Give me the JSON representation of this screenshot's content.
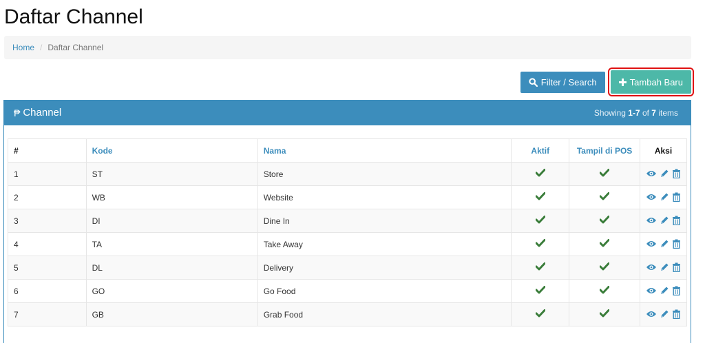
{
  "page": {
    "title": "Daftar Channel"
  },
  "breadcrumb": {
    "home": "Home",
    "separator": "/",
    "current": "Daftar Channel"
  },
  "toolbar": {
    "filter_label": "Filter / Search",
    "add_label": "Tambah Baru"
  },
  "panel": {
    "currency_icon": "₱",
    "title": "Channel",
    "showing_prefix": "Showing ",
    "range": "1-7",
    "of": " of ",
    "total": "7",
    "suffix": " items"
  },
  "table": {
    "headers": {
      "num": "#",
      "kode": "Kode",
      "nama": "Nama",
      "aktif": "Aktif",
      "tampil": "Tampil di POS",
      "aksi": "Aksi"
    },
    "rows": [
      {
        "num": "1",
        "kode": "ST",
        "nama": "Store",
        "aktif": true,
        "tampil": true
      },
      {
        "num": "2",
        "kode": "WB",
        "nama": "Website",
        "aktif": true,
        "tampil": true
      },
      {
        "num": "3",
        "kode": "DI",
        "nama": "Dine In",
        "aktif": true,
        "tampil": true
      },
      {
        "num": "4",
        "kode": "TA",
        "nama": "Take Away",
        "aktif": true,
        "tampil": true
      },
      {
        "num": "5",
        "kode": "DL",
        "nama": "Delivery",
        "aktif": true,
        "tampil": true
      },
      {
        "num": "6",
        "kode": "GO",
        "nama": "Go Food",
        "aktif": true,
        "tampil": true
      },
      {
        "num": "7",
        "kode": "GB",
        "nama": "Grab Food",
        "aktif": true,
        "tampil": true
      }
    ]
  },
  "icons": {
    "search": "search-icon",
    "plus": "plus-icon",
    "check": "check-icon",
    "view": "eye-icon",
    "edit": "pencil-icon",
    "delete": "trash-icon"
  },
  "colors": {
    "primary": "#3c8dbc",
    "add_button": "#4db8a8",
    "highlight": "#e01010",
    "check": "#3a7d3a"
  }
}
